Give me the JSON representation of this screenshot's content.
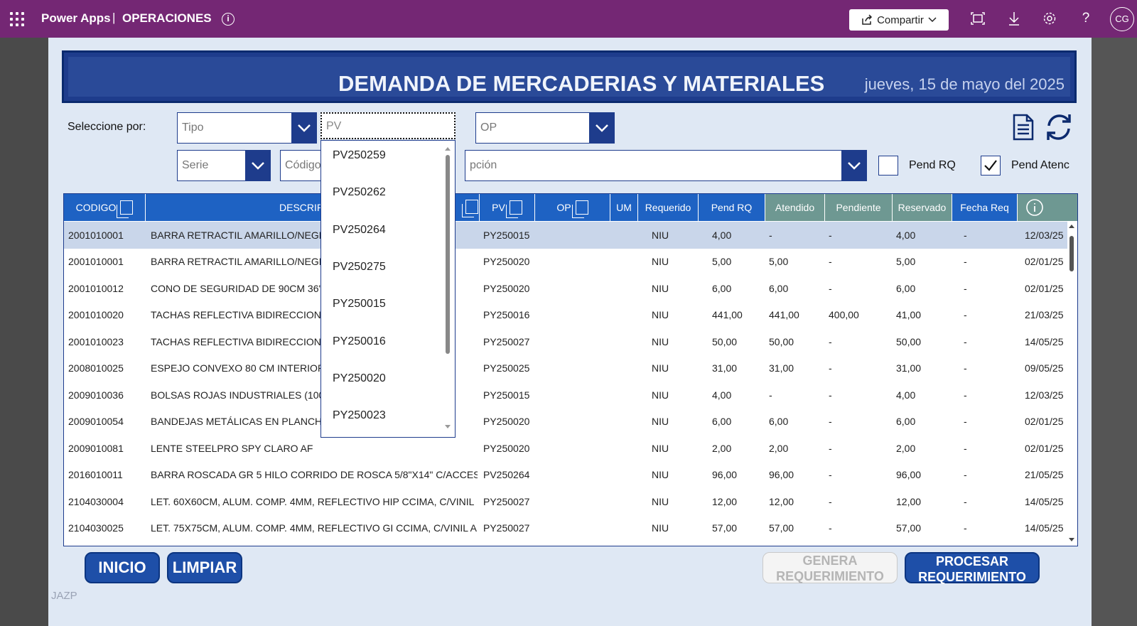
{
  "topbar": {
    "app": "Power Apps",
    "sep": "|",
    "name": "OPERACIONES",
    "share": "Compartir",
    "user": "CG"
  },
  "header": {
    "title": "DEMANDA DE MERCADERIAS Y MATERIALES",
    "date": "jueves, 15 de mayo del 2025"
  },
  "filters": {
    "label": "Seleccione por:",
    "tipo": "Tipo",
    "pv": "PV",
    "op": "OP",
    "serie": "Serie",
    "codigo": "Código",
    "descripcion": "pción"
  },
  "checks": {
    "pend_rq": "Pend RQ",
    "pend_atenc": "Pend Atenc",
    "pend_rq_checked": false,
    "pend_atenc_checked": true
  },
  "columns": [
    "CODIGO",
    "DESCRIPC",
    "PV",
    "OP",
    "UM",
    "Requerido",
    "Pend RQ",
    "Atendido",
    "Pendiente",
    "Reservado",
    "Fecha Req"
  ],
  "rows": [
    [
      "2001010001",
      "BARRA RETRACTIL AMARILLO/NEGRO",
      "PY250015",
      "NIU",
      "4,00",
      "-",
      "-",
      "4,00",
      "-",
      "12/03/25",
      "!"
    ],
    [
      "2001010001",
      "BARRA RETRACTIL AMARILLO/NEGRO",
      "PY250020",
      "NIU",
      "5,00",
      "5,00",
      "-",
      "5,00",
      "-",
      "02/01/25",
      "!"
    ],
    [
      "2001010012",
      "CONO DE SEGURIDAD DE 90CM 36\" C",
      "PY250020",
      "NIU",
      "6,00",
      "6,00",
      "-",
      "6,00",
      "-",
      "02/01/25",
      "!"
    ],
    [
      "2001010020",
      "TACHAS REFLECTIVA BIDIRECCIONAL",
      "PY250016",
      "NIU",
      "441,00",
      "441,00",
      "400,00",
      "41,00",
      "-",
      "21/03/25",
      "!"
    ],
    [
      "2001010023",
      "TACHAS REFLECTIVA BIDIRECCIONAL",
      "PY250027",
      "NIU",
      "50,00",
      "50,00",
      "-",
      "50,00",
      "-",
      "14/05/25",
      "!"
    ],
    [
      "2008010025",
      "ESPEJO CONVEXO 80 CM INTERIOR",
      "PY250025",
      "NIU",
      "31,00",
      "31,00",
      "-",
      "31,00",
      "-",
      "09/05/25",
      "!"
    ],
    [
      "2009010036",
      "BOLSAS ROJAS INDUSTRIALES (100 U",
      "PY250015",
      "NIU",
      "4,00",
      "-",
      "-",
      "4,00",
      "-",
      "12/03/25",
      "!"
    ],
    [
      "2009010054",
      "BANDEJAS METÁLICAS EN PLANCHA C                              O...",
      "PY250020",
      "NIU",
      "6,00",
      "6,00",
      "-",
      "6,00",
      "-",
      "02/01/25",
      "!"
    ],
    [
      "2009010081",
      "LENTE STEELPRO SPY CLARO AF",
      "PY250020",
      "NIU",
      "2,00",
      "2,00",
      "-",
      "2,00",
      "-",
      "02/01/25",
      "!"
    ],
    [
      "2016010011",
      "BARRA ROSCADA GR 5 HILO CORRIDO DE ROSCA 5/8\"X14\" C/ACCES...",
      "PV250264",
      "NIU",
      "96,00",
      "96,00",
      "-",
      "96,00",
      "-",
      "21/05/25",
      ""
    ],
    [
      "2104030004",
      "LET. 60X60CM, ALUM. COMP. 4MM, REFLECTIVO HIP CCIMA, C/VINIL ...",
      "PY250027",
      "NIU",
      "12,00",
      "12,00",
      "-",
      "12,00",
      "-",
      "14/05/25",
      "!"
    ],
    [
      "2104030025",
      "LET. 75X75CM, ALUM. COMP. 4MM, REFLECTIVO GI CCIMA, C/VINIL A...",
      "PY250027",
      "NIU",
      "57,00",
      "57,00",
      "-",
      "57,00",
      "-",
      "14/05/25",
      "!"
    ]
  ],
  "dropdown": [
    "PV250259",
    "PV250262",
    "PV250264",
    "PV250275",
    "PY250015",
    "PY250016",
    "PY250020",
    "PY250023"
  ],
  "buttons": {
    "inicio": "INICIO",
    "limpiar": "LIMPIAR",
    "genera_1": "GENERA",
    "genera_2": "REQUERIMIENTO",
    "procesar_1": "PROCESAR",
    "procesar_2": "REQUERIMIENTO"
  },
  "footer": "JAZP"
}
